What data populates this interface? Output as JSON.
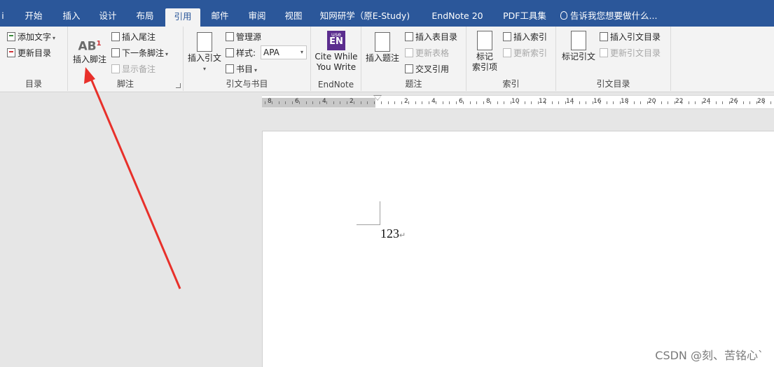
{
  "tabs": [
    {
      "label": "开始"
    },
    {
      "label": "插入"
    },
    {
      "label": "设计"
    },
    {
      "label": "布局"
    },
    {
      "label": "引用"
    },
    {
      "label": "邮件"
    },
    {
      "label": "审阅"
    },
    {
      "label": "视图"
    },
    {
      "label": "知网研学（原E-Study)"
    },
    {
      "label": "EndNote 20"
    },
    {
      "label": "PDF工具集"
    }
  ],
  "active_tab": "引用",
  "tell_me": "告诉我您想要做什么...",
  "ribbon": {
    "toc": {
      "add_text": "添加文字",
      "update_toc": "更新目录",
      "label": "目录"
    },
    "footnotes": {
      "insert_footnote": "插入脚注",
      "insert_endnote": "插入尾注",
      "next_footnote": "下一条脚注",
      "show_notes": "显示备注",
      "label": "脚注"
    },
    "citations": {
      "insert_citation": "插入引文",
      "manage_sources": "管理源",
      "style_label": "样式:",
      "style_value": "APA",
      "bibliography": "书目",
      "label": "引文与书目"
    },
    "endnote": {
      "icon_top": "use",
      "icon_main": "EN",
      "cite_line1": "Cite While",
      "cite_line2": "You Write",
      "label": "EndNote"
    },
    "captions": {
      "insert_caption": "插入题注",
      "insert_table_of_figures": "插入表目录",
      "update_table": "更新表格",
      "cross_reference": "交叉引用",
      "label": "题注"
    },
    "index": {
      "mark_entry_line1": "标记",
      "mark_entry_line2": "索引项",
      "insert_index": "插入索引",
      "update_index": "更新索引",
      "label": "索引"
    },
    "toa": {
      "mark_citation": "标记引文",
      "insert_toa": "插入引文目录",
      "update_toa": "更新引文目录",
      "label": "引文目录"
    }
  },
  "ruler": {
    "left_numbers": [
      "8",
      "6",
      "4",
      "2"
    ],
    "right_numbers": [
      "2",
      "4",
      "6",
      "8",
      "10",
      "12",
      "14",
      "16",
      "18",
      "20",
      "22",
      "24",
      "26",
      "28"
    ]
  },
  "document": {
    "text": "123",
    "paragraph_mark": "↵"
  },
  "watermark": "CSDN @刻、苦铭心`",
  "colors": {
    "ribbon_tab_bar": "#2b579a",
    "arrow": "#e8302a"
  }
}
